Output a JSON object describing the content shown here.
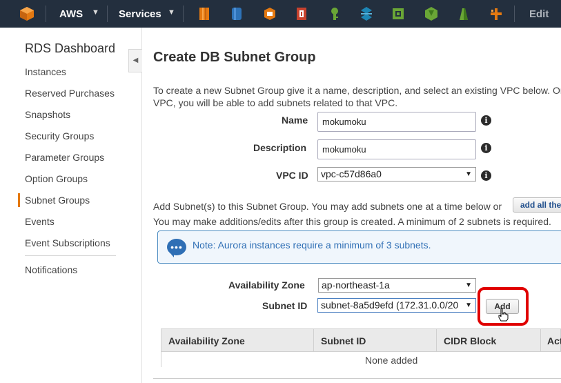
{
  "topbar": {
    "aws_label": "AWS",
    "services_label": "Services",
    "edit_label": "Edit",
    "service_icons": [
      "ec2-icon",
      "dynamodb-icon",
      "s3-icon",
      "cloudfront-icon",
      "iam-icon",
      "cloudwatch-icon",
      "vpc-icon",
      "lambda-icon",
      "elastic-beanstalk-icon",
      "cloudformation-icon"
    ],
    "colors": {
      "bg": "#232f3e",
      "orange": "#e47911",
      "blue": "#2e73b8",
      "green": "#6aa636",
      "red": "#c7422e",
      "teal": "#1d86b5"
    }
  },
  "sidebar": {
    "title": "RDS Dashboard",
    "items": [
      {
        "label": "Instances"
      },
      {
        "label": "Reserved Purchases"
      },
      {
        "label": "Snapshots"
      },
      {
        "label": "Security Groups"
      },
      {
        "label": "Parameter Groups"
      },
      {
        "label": "Option Groups"
      },
      {
        "label": "Subnet Groups",
        "active": true
      },
      {
        "label": "Events"
      },
      {
        "label": "Event Subscriptions"
      },
      {
        "label": "Notifications"
      }
    ],
    "active_color": "#e47911"
  },
  "main": {
    "title": "Create DB Subnet Group",
    "intro_line1": "To create a new Subnet Group give it a name, description, and select an existing VPC below. Once",
    "intro_line2": "VPC, you will be able to add subnets related to that VPC.",
    "form": {
      "name_label": "Name",
      "name_value": "mokumoku",
      "description_label": "Description",
      "description_value": "mokumoku",
      "vpc_label": "VPC ID",
      "vpc_value": "vpc-c57d86a0"
    },
    "add_subnets_line1": "Add Subnet(s) to this Subnet Group. You may add subnets one at a time below or",
    "add_subnets_line2": "You may make additions/edits after this group is created. A minimum of 2 subnets is required.",
    "add_all_label": "add all the",
    "note": "Note: Aurora instances require a minimum of 3 subnets.",
    "az_label": "Availability Zone",
    "az_value": "ap-northeast-1a",
    "subnet_label": "Subnet ID",
    "subnet_value": "subnet-8a5d9efd (172.31.0.0/20",
    "add_label": "Add",
    "table": {
      "columns": [
        "Availability Zone",
        "Subnet ID",
        "CIDR Block",
        "Act"
      ],
      "empty_text": "None added"
    },
    "highlight_color": "#e00000",
    "note_color": "#2f6fb5"
  }
}
